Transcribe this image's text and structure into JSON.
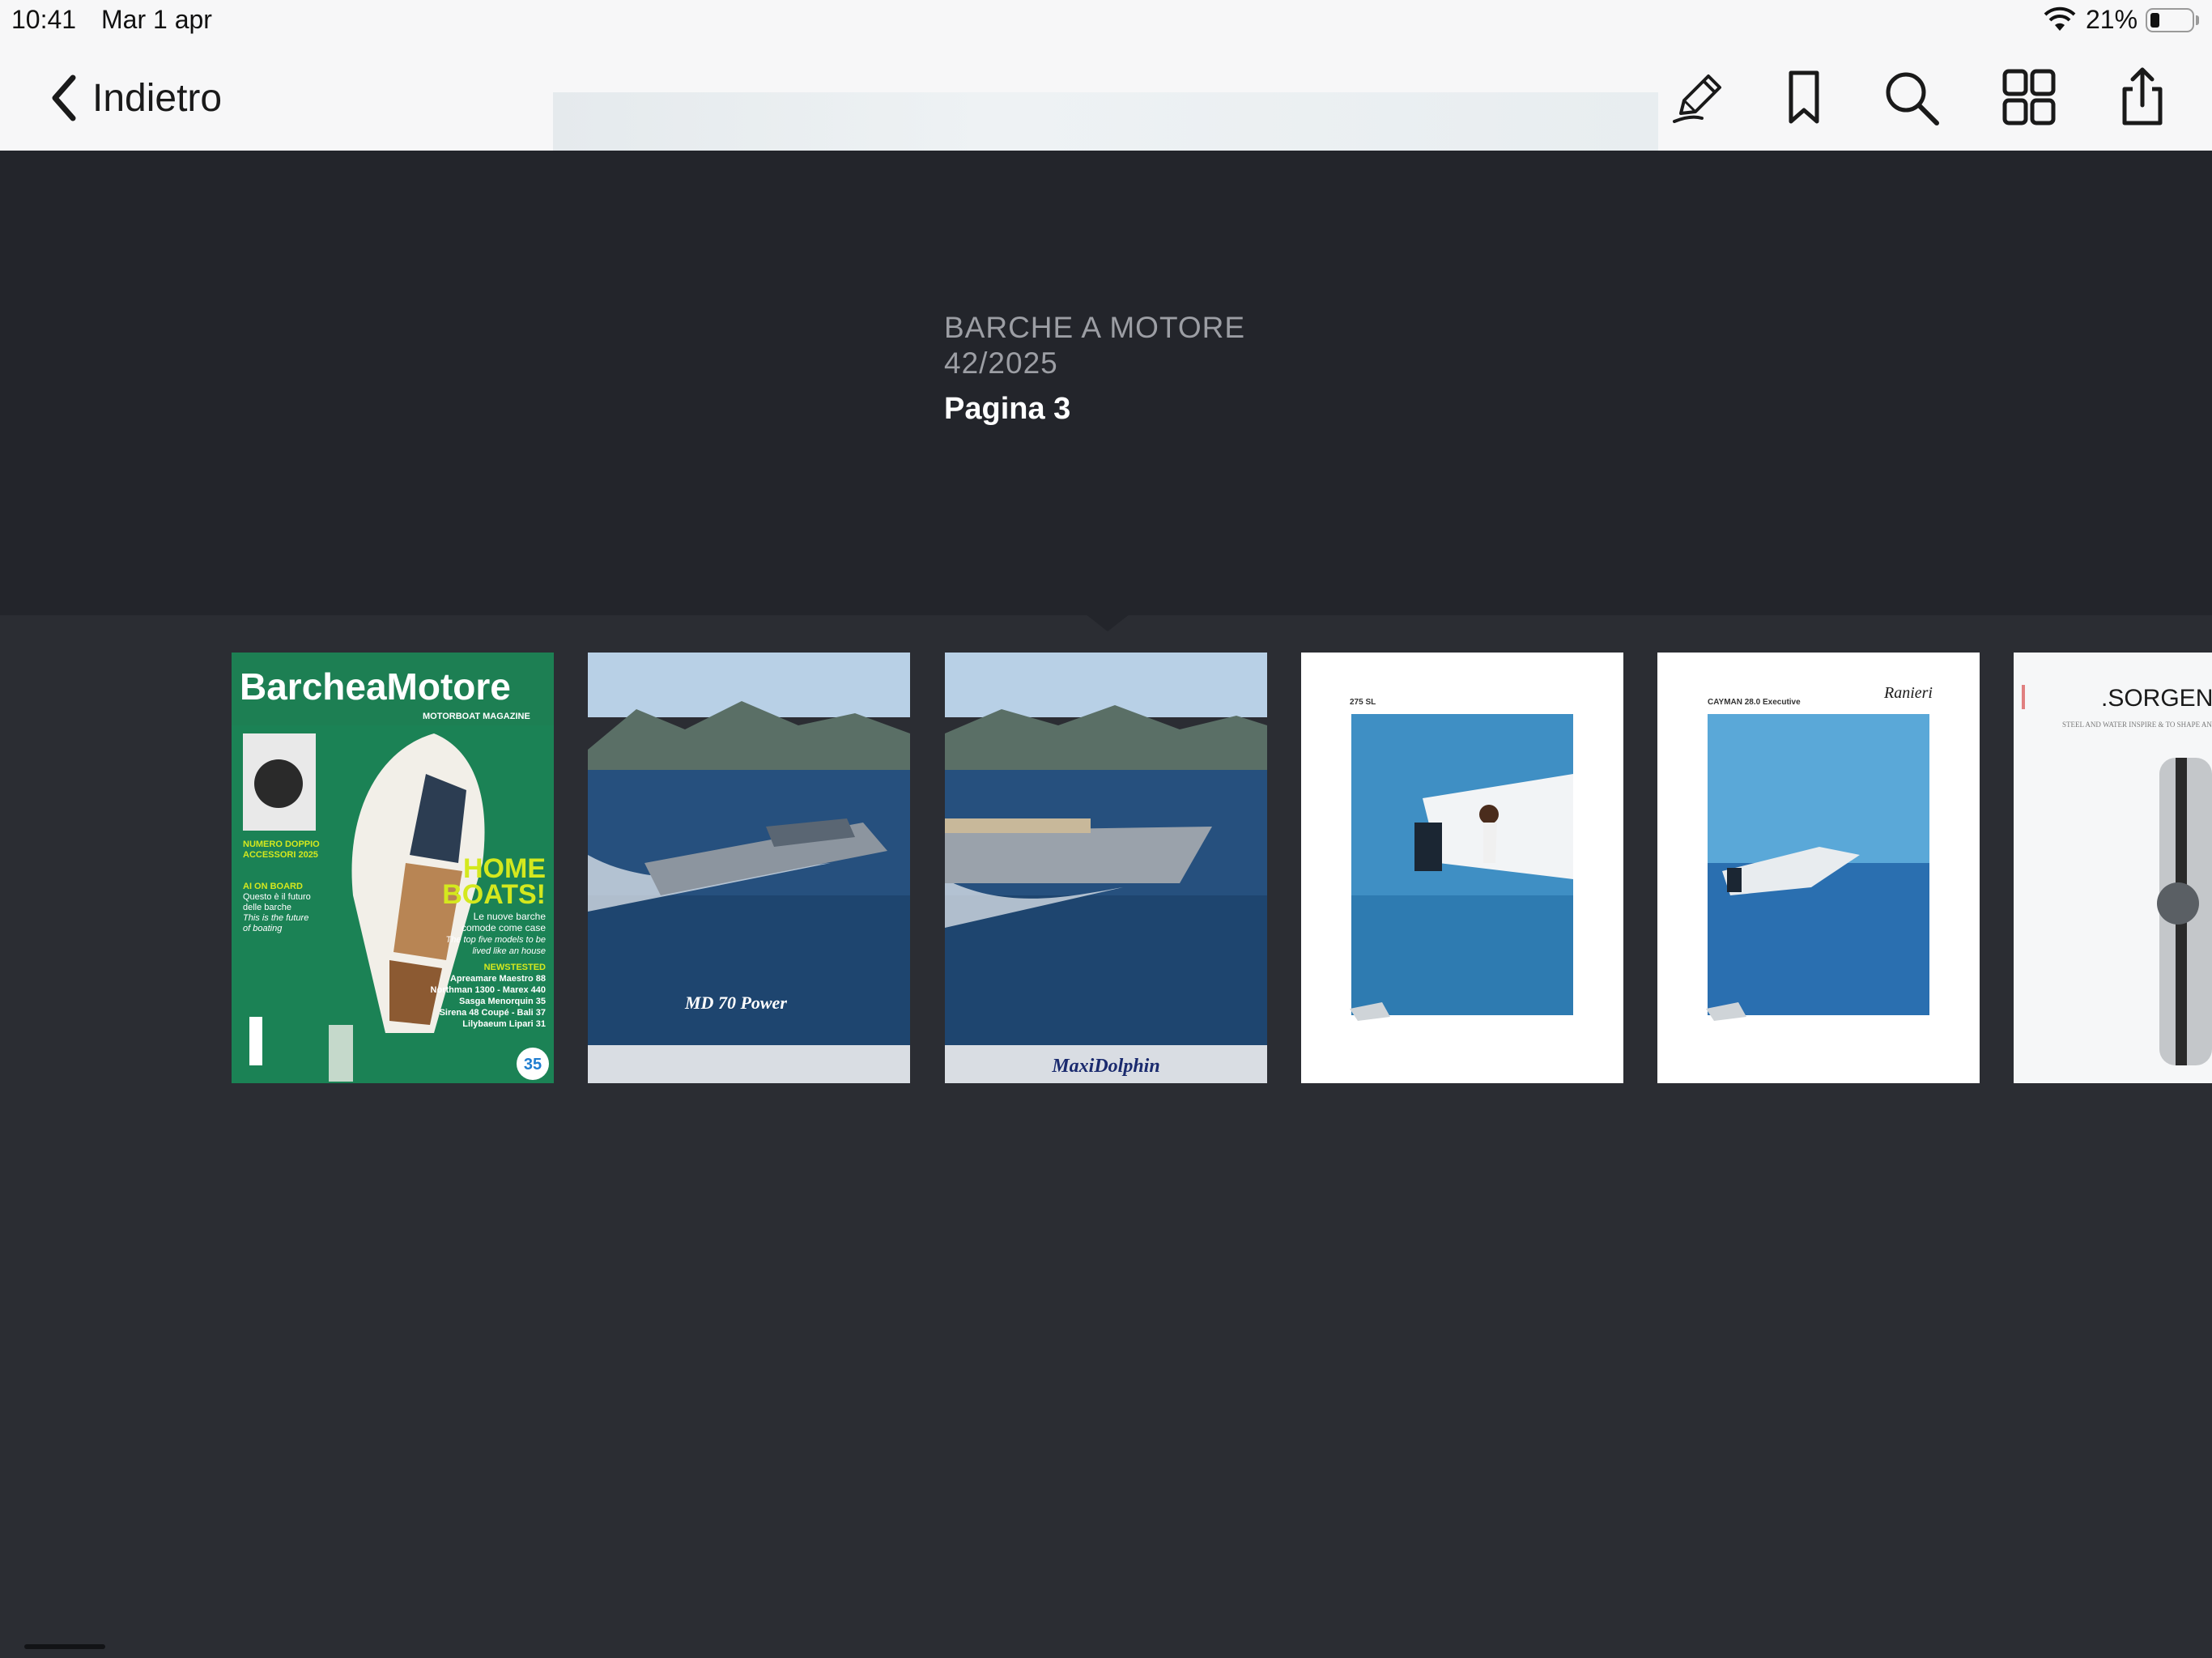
{
  "status_bar": {
    "time": "10:41",
    "date": "Mar 1 apr",
    "battery": "21%",
    "battery_level": 0.21
  },
  "nav": {
    "back_label": "Indietro",
    "toolbar_icons": [
      "pencil-icon",
      "bookmark-icon",
      "search-icon",
      "grid-icon",
      "share-icon"
    ]
  },
  "issue": {
    "title": "BARCHE A MOTORE",
    "number": "42/2025",
    "current_page": "Pagina 3"
  },
  "pages": [
    {
      "cover_title": "BarcheaMotore",
      "cover_subtitle": "MOTORBOAT MAGAZINE",
      "badge": "35",
      "blurbs": [
        "NUMERO DOPPIO",
        "ACCESSORI 2025",
        "AI ON BOARD",
        "Questo è il futuro",
        "delle barche",
        "This is the future",
        "of boating",
        "HOME",
        "BOATS!",
        "Le nuove barche",
        "comode come case",
        "The top five models to be",
        "lived like an house",
        "NEWSTESTED",
        "Apreamare Maestro 88",
        "Northman 1300 - Marex 440",
        "Sasga Menorquin 35",
        "Sirena 48 Coupé - Bali 37",
        "Lilybaeum Lipari 31"
      ]
    },
    {
      "ad_text": "MD 70 Power"
    },
    {
      "ad_text": "MaxiDolphin"
    },
    {
      "ad_text": "275 SL"
    },
    {
      "ad_text": "CAYMAN 28.0 Executive",
      "brand": "Ranieri"
    },
    {
      "ad_text": ".SORGEN",
      "tagline": "STEEL AND WATER INSPIRE & TO SHAPE AN OBJECT OF EXCE"
    }
  ],
  "colors": {
    "nav_bg": "#f7f7f8",
    "header_bg": "#23252b",
    "body_bg": "#2b2d33",
    "cover_green": "#1f7d52",
    "cover_accent": "#d4e81e"
  }
}
